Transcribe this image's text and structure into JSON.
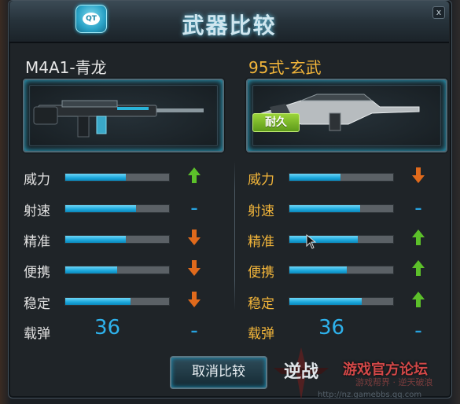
{
  "window": {
    "title": "武器比较",
    "close_label": "x",
    "logo_label": "QT"
  },
  "left_weapon": {
    "name": "M4A1-青龙",
    "stats": [
      {
        "label": "威力",
        "fill": 0.58,
        "trend": "up"
      },
      {
        "label": "射速",
        "fill": 0.68,
        "trend": "same"
      },
      {
        "label": "精准",
        "fill": 0.58,
        "trend": "down"
      },
      {
        "label": "便携",
        "fill": 0.5,
        "trend": "down"
      },
      {
        "label": "稳定",
        "fill": 0.63,
        "trend": "down"
      }
    ],
    "ammo": {
      "label": "载弹",
      "value": "36",
      "trend": "same"
    }
  },
  "right_weapon": {
    "name": "95式-玄武",
    "badge": "耐久",
    "stats": [
      {
        "label": "威力",
        "fill": 0.49,
        "trend": "down"
      },
      {
        "label": "射速",
        "fill": 0.68,
        "trend": "same"
      },
      {
        "label": "精准",
        "fill": 0.66,
        "trend": "up"
      },
      {
        "label": "便携",
        "fill": 0.55,
        "trend": "up"
      },
      {
        "label": "稳定",
        "fill": 0.7,
        "trend": "up"
      }
    ],
    "ammo": {
      "label": "载弹",
      "value": "36",
      "trend": "same"
    }
  },
  "trend_symbols": {
    "same": "–"
  },
  "colors": {
    "up": "#5cc02a",
    "down": "#e06a1c",
    "same": "#27a3e0",
    "bar": "#1aa7dc"
  },
  "buttons": {
    "cancel_compare": "取消比较"
  },
  "branding": {
    "logo": "逆战",
    "slogan": "游戏官方论坛",
    "sub": "游戏帮界 · 逆天破浪",
    "url": "http://nz.gamebbs.qq.com"
  }
}
